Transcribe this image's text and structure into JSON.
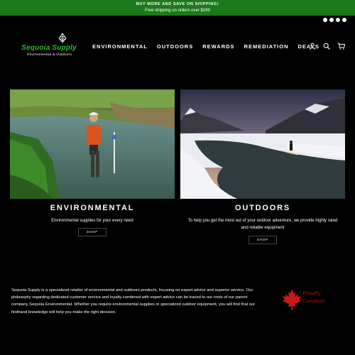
{
  "announcement": {
    "line1": "BUY MORE AND SAVE ON SHIPPING!",
    "line2": "Free shipping on orders over $249"
  },
  "social_icons": [
    "instagram-icon",
    "facebook-icon",
    "youtube-icon",
    "linkedin-icon"
  ],
  "logo": {
    "brand": "Sequoia Supply",
    "tagline": "Environmental & Outdoors"
  },
  "nav": [
    "ENVIRONMENTAL",
    "OUTDOORS",
    "REWARDS",
    "REMEDIATION",
    "DEALS"
  ],
  "header_icons": [
    "account-icon",
    "search-icon",
    "cart-icon"
  ],
  "collections": [
    {
      "title": "ENVIRONMENTAL",
      "description": "Environmental supplies for your every need",
      "button": "SHOP"
    },
    {
      "title": "OUTDOORS",
      "description_line1": "To help you get the most out of your outdoor adventure, we provide highly rated",
      "description_line2": "and reliable equipment",
      "button": "SHOP"
    }
  ],
  "about": {
    "text": "Sequoia Supply is a specialized retailer of environmental and outdoors products, focusing on expert advice and superior service.  Our philosophy regarding dedicated customer service and loyalty combined with expert advice can be traced to our roots of our parent company Sequoia Environmental.  Whether you require environmental supplies or specialized outdoor equipment, you will find that our firsthand knowledge will help you make the right decision."
  },
  "badge": {
    "line1": "Proudly",
    "line2": "Canadian"
  },
  "colors": {
    "announcement_bg": "#1c7a1a",
    "brand_green": "#2dbd2a",
    "canada_red": "#c81818"
  }
}
